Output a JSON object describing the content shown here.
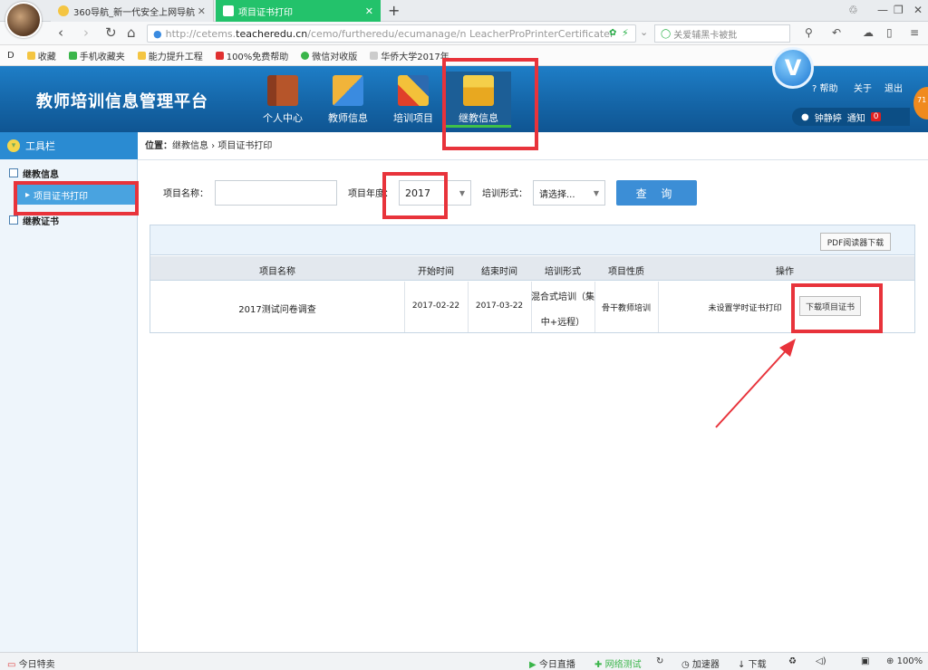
{
  "browser": {
    "tabs": [
      {
        "title": "360导航_新一代安全上网导航"
      },
      {
        "title": "项目证书打印"
      }
    ],
    "url": {
      "prefix": "http://cetems.",
      "host": "teacheredu.cn",
      "path": "/cemo/furtheredu/ecumanage/n LeacherProPrinterCertificateP"
    },
    "search_text": "关爱辅黑卡被批",
    "bookmarks": [
      "D",
      "收藏",
      "手机收藏夹",
      "能力提升工程",
      "100%免费帮助",
      "微信对收版",
      "华侨大学2017年"
    ]
  },
  "header": {
    "logo": "教师培训信息管理平台",
    "nav": [
      {
        "label": "个人中心",
        "icon": "book-icon"
      },
      {
        "label": "教师信息",
        "icon": "ruler-icon"
      },
      {
        "label": "培训项目",
        "icon": "tools-icon"
      },
      {
        "label": "继教信息",
        "icon": "folder-download-icon"
      }
    ],
    "links": {
      "help": "帮助",
      "about": "关于",
      "logout": "退出"
    },
    "user": {
      "name": "钟静婷",
      "notice": "通知",
      "count": "0"
    },
    "v_badge": "V",
    "side_badge": "71"
  },
  "sidebar": {
    "title": "工具栏",
    "section1": "继教信息",
    "active_item": "项目证书打印",
    "section2": "继教证书"
  },
  "breadcrumb": {
    "prefix": "位置：",
    "path": "继教信息 › 项目证书打印"
  },
  "filters": {
    "name_label": "项目名称：",
    "name_value": "",
    "year_label": "项目年度：",
    "year_value": "2017",
    "form_label": "培训形式：",
    "form_value": "请选择...",
    "query_label": "查 询"
  },
  "table": {
    "pdf_button": "PDF阅读器下载",
    "headers": [
      "项目名称",
      "开始时间",
      "结束时间",
      "培训形式",
      "项目性质",
      "操作"
    ],
    "rows": [
      {
        "name": "2017测试问卷调查",
        "start": "2017-02-22",
        "end": "2017-03-22",
        "form_line1": "混合式培训（集",
        "form_line2": "中+远程）",
        "nature": "骨干教师培训",
        "status": "未设置学时证书打印",
        "action": "下载项目证书"
      }
    ]
  },
  "statusbar": {
    "left": "今日特卖",
    "items": [
      "今日直播",
      "加速器",
      "下载",
      "100%"
    ],
    "highlight": "网络测试"
  },
  "colors": {
    "accent": "#2a8bd2",
    "highlight": "#e8333b",
    "active_tab": "#23c26b"
  }
}
